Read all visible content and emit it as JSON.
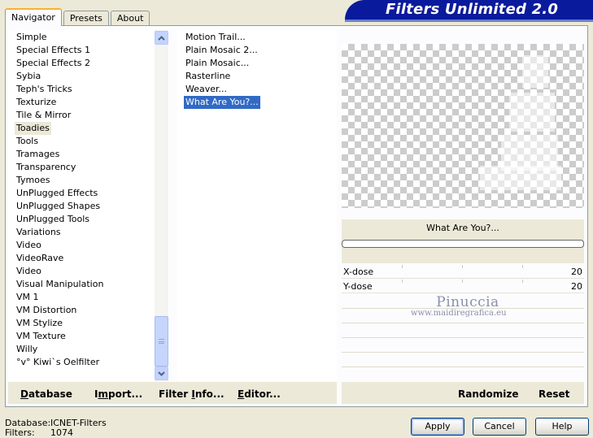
{
  "tabs": [
    {
      "label": "Navigator",
      "active": true
    },
    {
      "label": "Presets",
      "active": false
    },
    {
      "label": "About",
      "active": false
    }
  ],
  "banner": {
    "title": "Filters Unlimited 2.0"
  },
  "categories": {
    "items": [
      "Simple",
      "Special Effects 1",
      "Special Effects 2",
      "Sybia",
      "Teph's Tricks",
      "Texturize",
      "Tile & Mirror",
      "Toadies",
      "Tools",
      "Tramages",
      "Transparency",
      "Tymoes",
      "UnPlugged Effects",
      "UnPlugged Shapes",
      "UnPlugged Tools",
      "Variations",
      "Video",
      "VideoRave",
      "Video",
      "Visual Manipulation",
      "VM 1",
      "VM Distortion",
      "VM Stylize",
      "VM Texture",
      "Willy",
      "°v° Kiwi`s Oelfilter"
    ],
    "selected": "Toadies"
  },
  "filters": {
    "items": [
      "Motion Trail...",
      "Plain Mosaic 2...",
      "Plain Mosaic...",
      "Rasterline",
      "Weaver...",
      "What Are You?..."
    ],
    "selected": "What Are You?..."
  },
  "preview": {
    "filter_name": "What Are You?...",
    "params": [
      {
        "label": "X-dose",
        "value": "20"
      },
      {
        "label": "Y-dose",
        "value": "20"
      }
    ]
  },
  "watermark": {
    "line1": "Pinuccia",
    "line2": "www.maidiregrafica.eu"
  },
  "toolbar": {
    "database": {
      "u": "D",
      "rest": "atabase"
    },
    "import": {
      "pre": "I",
      "u": "m",
      "rest": "port..."
    },
    "filter_info": {
      "pre": "Filter ",
      "u": "I",
      "rest": "nfo..."
    },
    "editor": {
      "u": "E",
      "rest": "ditor..."
    },
    "randomize": "Randomize",
    "reset": "Reset"
  },
  "status": {
    "database_label": "Database:",
    "database_value": "ICNET-Filters",
    "filters_label": "Filters:",
    "filters_value": "1074"
  },
  "buttons": {
    "apply": "Apply",
    "cancel": "Cancel",
    "help": "Help"
  }
}
